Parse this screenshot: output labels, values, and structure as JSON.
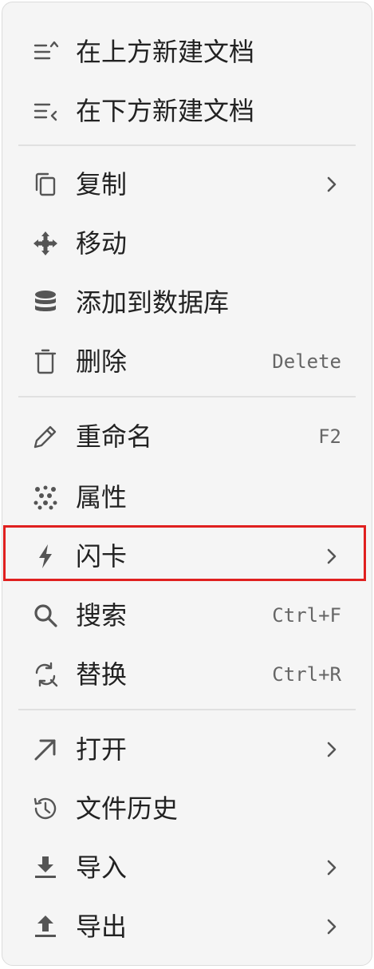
{
  "menu": {
    "items": [
      {
        "label": "在上方新建文档",
        "icon": "insert-above-icon"
      },
      {
        "label": "在下方新建文档",
        "icon": "insert-below-icon"
      },
      {
        "label": "复制",
        "icon": "copy-icon",
        "submenu": true
      },
      {
        "label": "移动",
        "icon": "move-icon"
      },
      {
        "label": "添加到数据库",
        "icon": "database-icon"
      },
      {
        "label": "删除",
        "icon": "trash-icon",
        "shortcut": "Delete"
      },
      {
        "label": "重命名",
        "icon": "pencil-icon",
        "shortcut": "F2"
      },
      {
        "label": "属性",
        "icon": "attributes-icon"
      },
      {
        "label": "闪卡",
        "icon": "flashcard-icon",
        "submenu": true,
        "highlighted": true
      },
      {
        "label": "搜索",
        "icon": "search-icon",
        "shortcut": "Ctrl+F"
      },
      {
        "label": "替换",
        "icon": "replace-icon",
        "shortcut": "Ctrl+R"
      },
      {
        "label": "打开",
        "icon": "open-arrow-icon",
        "submenu": true
      },
      {
        "label": "文件历史",
        "icon": "history-icon"
      },
      {
        "label": "导入",
        "icon": "import-icon",
        "submenu": true
      },
      {
        "label": "导出",
        "icon": "export-icon",
        "submenu": true
      }
    ]
  },
  "colors": {
    "background": "#f5f5f5",
    "text": "#222222",
    "icon": "#555555",
    "shortcut": "#666666",
    "separator": "#e0e0e0",
    "highlight_border": "#e0201f"
  }
}
